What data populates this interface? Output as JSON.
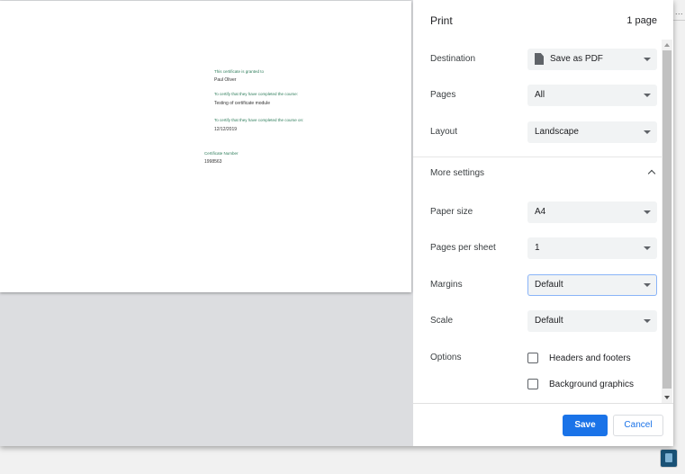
{
  "dialog": {
    "title": "Print",
    "page_count": "1 page"
  },
  "preview": {
    "granted_label": "This certificate is granted to",
    "recipient": "Paul Oliver",
    "course_label": "To certify that they have completed the course:",
    "course_name": "Testing of certificate module",
    "completed_on_label": "To certify that they have completed the course on:",
    "completed_date": "12/12/2019",
    "cert_number_label": "Certificate Number",
    "cert_number": "1998563"
  },
  "settings": {
    "destination": {
      "label": "Destination",
      "value": "Save as PDF",
      "icon": "pdf-file-icon"
    },
    "pages": {
      "label": "Pages",
      "value": "All"
    },
    "layout": {
      "label": "Layout",
      "value": "Landscape"
    },
    "more_settings": {
      "label": "More settings",
      "expanded": true
    },
    "paper_size": {
      "label": "Paper size",
      "value": "A4"
    },
    "pages_per_sheet": {
      "label": "Pages per sheet",
      "value": "1"
    },
    "margins": {
      "label": "Margins",
      "value": "Default"
    },
    "scale": {
      "label": "Scale",
      "value": "Default"
    },
    "options": {
      "label": "Options",
      "headers_footers": {
        "label": "Headers and footers",
        "checked": false
      },
      "background_graphics": {
        "label": "Background graphics",
        "checked": false
      }
    }
  },
  "footer": {
    "save_label": "Save",
    "cancel_label": "Cancel"
  },
  "underlay": {
    "ellipsis": "..."
  },
  "colors": {
    "accent": "#1a73e8",
    "certificate_label": "#2e7d5b",
    "preview_background": "#dcdde0"
  }
}
